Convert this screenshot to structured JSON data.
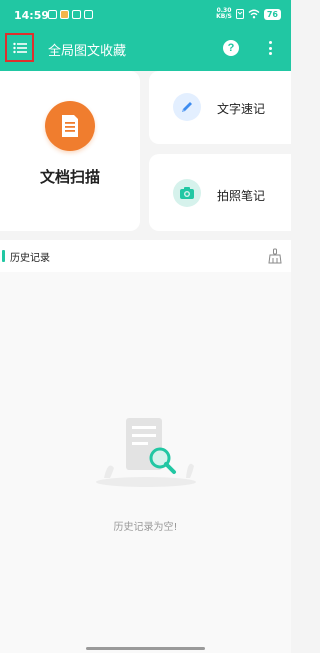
{
  "status": {
    "time": "14:59",
    "net_speed_value": "0.30",
    "net_speed_unit": "KB/S",
    "battery": "76"
  },
  "header": {
    "title": "全局图文收藏",
    "help_label": "?"
  },
  "cards": {
    "scan_label": "文档扫描",
    "note_label": "文字速记",
    "photo_label": "拍照笔记"
  },
  "history": {
    "title": "历史记录",
    "empty_text": "历史记录为空!"
  },
  "colors": {
    "accent": "#21c7a3",
    "scan_orange": "#f07d2e",
    "highlight_border": "#e0302c"
  }
}
